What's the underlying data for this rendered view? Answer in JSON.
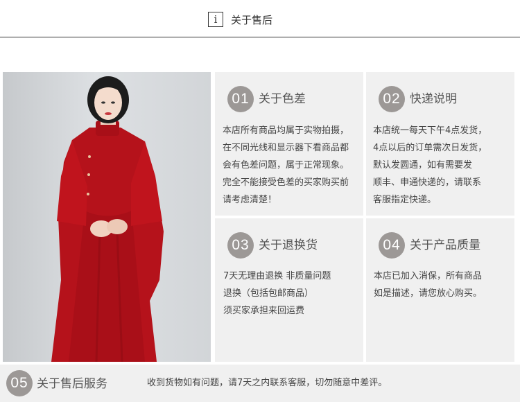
{
  "header": {
    "icon_glyph": "i",
    "title": "关于售后"
  },
  "photo": {
    "icon": "product-model-photo"
  },
  "cards": [
    {
      "num": "01",
      "title": "关于色差",
      "body": "本店所有商品均属于实物拍摄，\n在不同光线和显示器下看商品都\n会有色差问题，属于正常现象。\n完全不能接受色差的买家购买前\n请考虑清楚！"
    },
    {
      "num": "02",
      "title": "快递说明",
      "body": "本店统一每天下午4点发货，\n4点以后的订单需次日发货，\n默认发圆通，如有需要发\n顺丰、申通快递的，请联系\n客服指定快递。"
    },
    {
      "num": "03",
      "title": "关于退换货",
      "body": "7天无理由退换 非质量问题\n退换（包括包邮商品）\n须买家承担来回运费"
    },
    {
      "num": "04",
      "title": "关于产品质量",
      "body": "本店已加入消保，所有商品\n如是描述，请您放心购买。"
    }
  ],
  "service": {
    "num": "05",
    "title": "关于售后服务",
    "text": "收到货物如有问题，请7天之内联系客服，切勿随意中差评。"
  }
}
